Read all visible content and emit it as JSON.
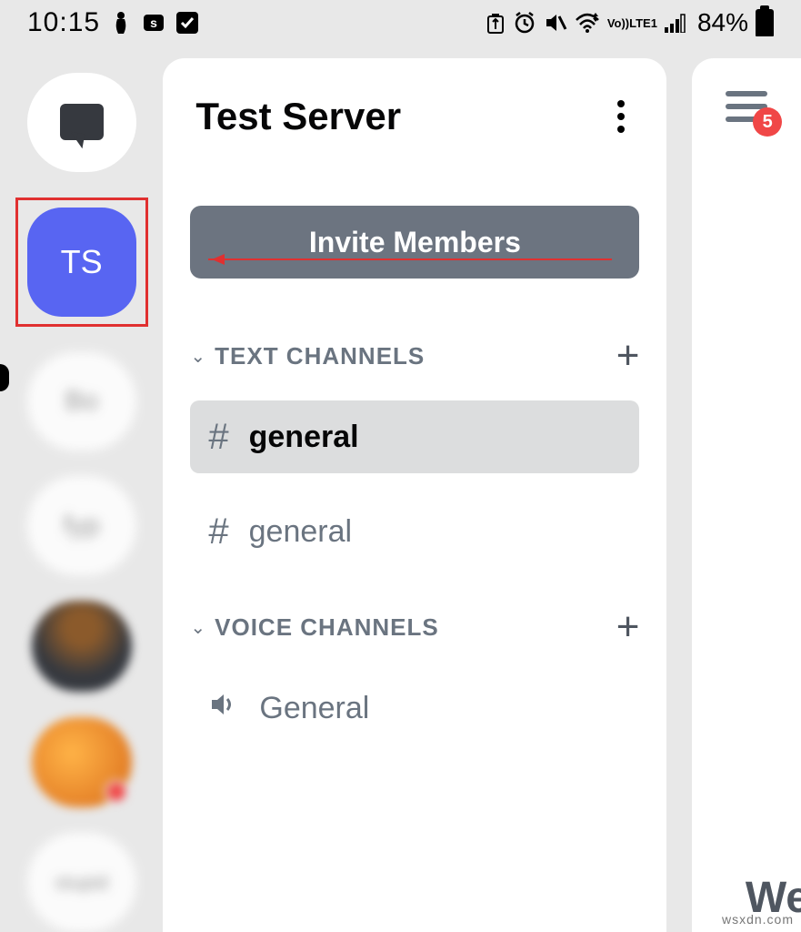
{
  "status": {
    "time": "10:15",
    "battery": "84%",
    "lte": "LTE1",
    "vo": "Vo))"
  },
  "rail": {
    "selected_initials": "TS"
  },
  "panel": {
    "title": "Test Server",
    "invite_label": "Invite Members",
    "categories": [
      {
        "name": "TEXT CHANNELS",
        "channels": [
          {
            "icon": "#",
            "name": "general",
            "active": true
          },
          {
            "icon": "#",
            "name": "general",
            "active": false
          }
        ]
      },
      {
        "name": "VOICE CHANNELS",
        "channels": [
          {
            "icon": "speaker",
            "name": "General",
            "active": false
          }
        ]
      }
    ]
  },
  "right": {
    "badge": "5",
    "welcome_fragment": "We"
  },
  "watermark": "wsxdn.com"
}
